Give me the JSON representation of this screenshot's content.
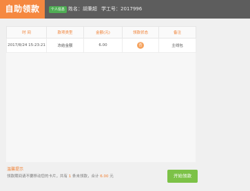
{
  "header": {
    "title": "自助领款",
    "badge": "个人信息",
    "user_name": "姓名：胡秉超",
    "user_id": "学工号：2017996"
  },
  "table": {
    "columns": [
      "时 间",
      "款项类型",
      "金额(元)",
      "领款状态",
      "备注"
    ],
    "rows": [
      {
        "time": "2017/8/24 15:23:21",
        "type": "冻结金额",
        "amount": "6.00",
        "status": "否",
        "note": "主线包"
      }
    ]
  },
  "notice": {
    "title": "温馨提示",
    "text_prefix": "领款期间请不要移动您的卡片，共有",
    "count": "1",
    "text_middle": "条未领款，合计",
    "total": "6.00",
    "unit": "元"
  },
  "actions": {
    "start_label": "开始领款"
  },
  "colors": {
    "accent_orange": "#f58840",
    "header_bg": "#5d5d5d",
    "button_green": "#7cc247",
    "badge_green": "#4fae54"
  }
}
